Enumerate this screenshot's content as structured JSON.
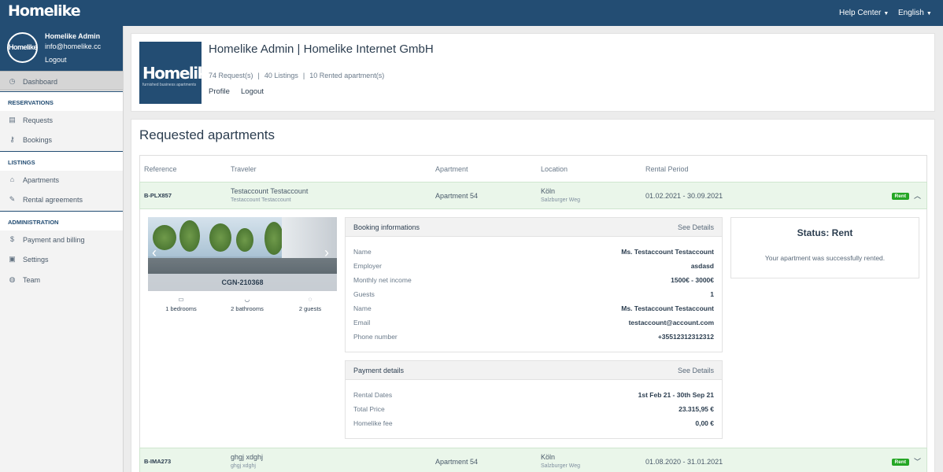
{
  "topbar": {
    "logo": "Homelike",
    "help_center": "Help Center",
    "language": "English"
  },
  "user": {
    "avatar_text": "Homelike",
    "name": "Homelike Admin",
    "email": "info@homelike.cc",
    "logout": "Logout"
  },
  "sidebar": {
    "dashboard": "Dashboard",
    "sections": [
      {
        "title": "RESERVATIONS",
        "items": [
          "Requests",
          "Bookings"
        ]
      },
      {
        "title": "LISTINGS",
        "items": [
          "Apartments",
          "Rental agreements"
        ]
      },
      {
        "title": "ADMINISTRATION",
        "items": [
          "Payment and billing",
          "Settings",
          "Team"
        ]
      }
    ]
  },
  "profile": {
    "logo_text": "Homelike",
    "logo_tagline": "furnished business apartments",
    "title": "Homelike Admin | Homelike Internet GmbH",
    "requests": "74 Request(s)",
    "listings": "40 Listings",
    "rented": "10 Rented apartment(s)",
    "links": [
      "Profile",
      "Logout"
    ]
  },
  "requests": {
    "title": "Requested apartments",
    "columns": [
      "Reference",
      "Traveler",
      "Apartment",
      "Location",
      "Rental Period"
    ],
    "rows": [
      {
        "reference": "B-PLX857",
        "traveler": "Testaccount Testaccount",
        "traveler_sub": "Testaccount Testaccount",
        "apartment": "Apartment 54",
        "location": "Köln",
        "location_sub": "Salzburger Weg",
        "period": "01.02.2021 - 30.09.2021",
        "status": "Rent",
        "chevron": "up"
      },
      {
        "reference": "B-IMA273",
        "traveler": "ghgj xdghj",
        "traveler_sub": "ghgj xdghj",
        "apartment": "Apartment 54",
        "location": "Köln",
        "location_sub": "Salzburger Weg",
        "period": "01.08.2020 - 31.01.2021",
        "status": "Rent",
        "chevron": "down"
      }
    ]
  },
  "detail": {
    "apartment_code": "CGN-210368",
    "features": [
      "1 bedrooms",
      "2 bathrooms",
      "2 guests"
    ],
    "booking": {
      "title": "Booking informations",
      "see_details": "See Details",
      "fields": [
        {
          "label": "Name",
          "value": "Ms. Testaccount Testaccount"
        },
        {
          "label": "Employer",
          "value": "asdasd"
        },
        {
          "label": "Monthly net income",
          "value": "1500€ - 3000€"
        },
        {
          "label": "Guests",
          "value": "1"
        },
        {
          "label": "Name",
          "value": "Ms. Testaccount Testaccount"
        },
        {
          "label": "Email",
          "value": "testaccount@account.com"
        },
        {
          "label": "Phone number",
          "value": "+35512312312312"
        }
      ]
    },
    "payment": {
      "title": "Payment details",
      "see_details": "See Details",
      "fields": [
        {
          "label": "Rental Dates",
          "value": "1st Feb 21 - 30th Sep 21"
        },
        {
          "label": "Total Price",
          "value": "23.315,95 €"
        },
        {
          "label": "Homelike fee",
          "value": "0,00 €"
        }
      ]
    },
    "status": {
      "title": "Status: Rent",
      "message": "Your apartment was successfully rented."
    }
  },
  "colors": {
    "brand": "#234d73",
    "rent_badge": "#24a624",
    "row_highlight": "#eaf6ea"
  }
}
